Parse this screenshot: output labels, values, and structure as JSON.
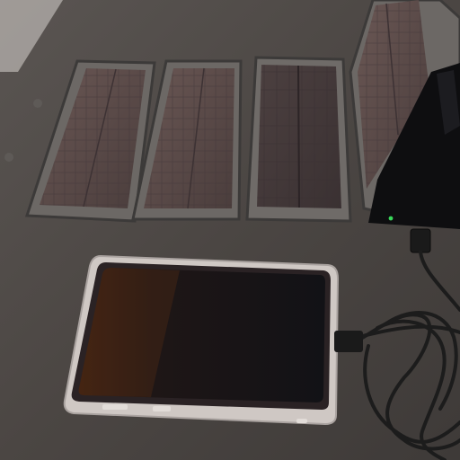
{
  "image": {
    "subject": "foldable-solar-charger-with-phone",
    "objects": [
      {
        "name": "solar-panel",
        "count": 4
      },
      {
        "name": "smartphone",
        "count": 1
      },
      {
        "name": "charging-cable",
        "count": 1
      },
      {
        "name": "power-bank-case",
        "count": 1
      }
    ],
    "colors": {
      "table": "#4a4542",
      "panel_frame": "#6b6764",
      "panel_cell": "#5a4a46",
      "phone_screen": "#1a1516",
      "phone_case": "#c9c2be",
      "cable": "#1c1c1c",
      "indicator_led": "#39d85a"
    }
  }
}
